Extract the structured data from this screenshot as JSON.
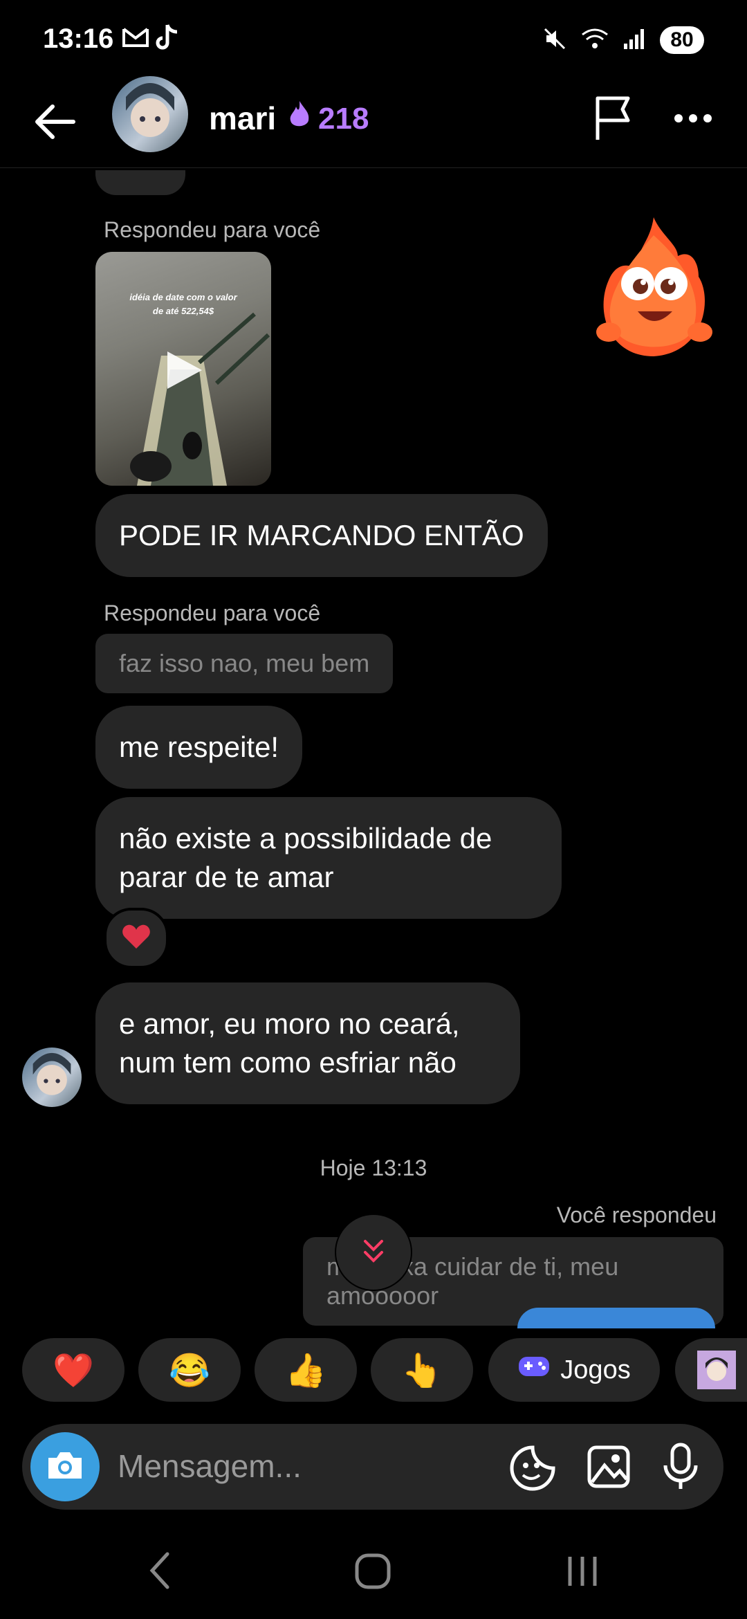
{
  "status": {
    "time": "13:16",
    "battery": "80"
  },
  "header": {
    "name": "mari",
    "streak": "218"
  },
  "chat": {
    "reply_label_1": "Respondeu para você",
    "video_caption": "idéia de date com o valor de até 522,54$",
    "msg_1": "PODE IR MARCANDO ENTÃO",
    "reply_label_2": "Respondeu para você",
    "quoted_1": "faz isso nao, meu bem",
    "msg_2": "me respeite!",
    "msg_3": "não existe a possibilidade de parar de te amar",
    "msg_4": "e amor, eu moro no ceará, num tem como esfriar não",
    "timestamp": "Hoje 13:13",
    "you_replied": "Você respondeu",
    "quoted_2": "me deixa cuidar de ti, meu amooooor"
  },
  "quick_reactions": {
    "heart": "❤️",
    "laugh": "😂",
    "thumbs": "👍",
    "point": "👆",
    "games": "Jogos"
  },
  "composer": {
    "placeholder": "Mensagem..."
  }
}
